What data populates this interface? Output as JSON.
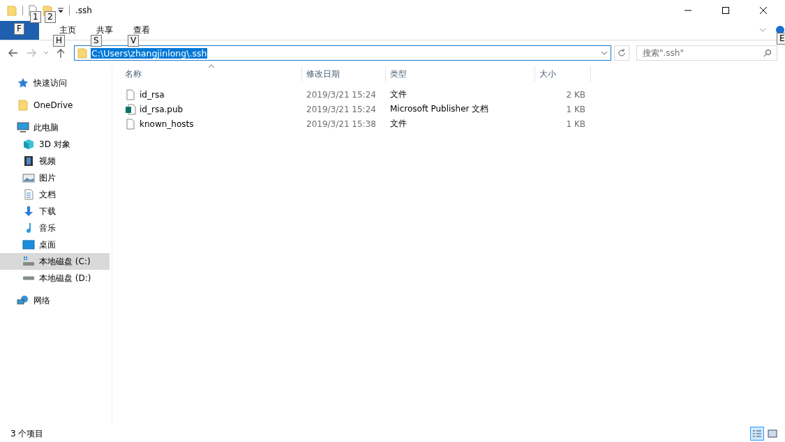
{
  "title_bar": {
    "title": ".ssh",
    "keytips": [
      "1",
      "2"
    ]
  },
  "ribbon": {
    "tabs": [
      {
        "keytip": "F",
        "kind": "file"
      },
      {
        "label": "主页",
        "keytip": "H",
        "kind": "tab"
      },
      {
        "label": "共享",
        "keytip": "S",
        "kind": "tab"
      },
      {
        "label": "查看",
        "keytip": "V",
        "kind": "tab"
      }
    ],
    "help_keytip": "E"
  },
  "address_bar": {
    "path": "C:\\Users\\zhangjinlong\\.ssh",
    "selected": true
  },
  "search": {
    "placeholder": "搜索\".ssh\""
  },
  "sidebar": {
    "items": [
      {
        "label": "快速访问",
        "kind": "star",
        "selected": false
      },
      {
        "label": "OneDrive",
        "kind": "folder",
        "selected": false
      },
      {
        "label": "此电脑",
        "kind": "pc",
        "selected": false,
        "children": [
          {
            "label": "3D 对象",
            "kind": "cube",
            "selected": false
          },
          {
            "label": "视频",
            "kind": "film",
            "selected": false
          },
          {
            "label": "图片",
            "kind": "picture",
            "selected": false
          },
          {
            "label": "文档",
            "kind": "document",
            "selected": false
          },
          {
            "label": "下载",
            "kind": "download",
            "selected": false
          },
          {
            "label": "音乐",
            "kind": "music",
            "selected": false
          },
          {
            "label": "桌面",
            "kind": "desktop",
            "selected": false
          },
          {
            "label": "本地磁盘 (C:)",
            "kind": "systemdrive",
            "selected": true
          },
          {
            "label": "本地磁盘 (D:)",
            "kind": "drive",
            "selected": false
          }
        ]
      },
      {
        "label": "网络",
        "kind": "network",
        "selected": false
      }
    ]
  },
  "file_list": {
    "columns": [
      "名称",
      "修改日期",
      "类型",
      "大小"
    ],
    "rows": [
      {
        "name": "id_rsa",
        "modified": "2019/3/21 15:24",
        "type": "文件",
        "size": "2 KB",
        "kind": "file"
      },
      {
        "name": "id_rsa.pub",
        "modified": "2019/3/21 15:24",
        "type": "Microsoft Publisher 文档",
        "size": "1 KB",
        "kind": "publisher"
      },
      {
        "name": "known_hosts",
        "modified": "2019/3/21 15:38",
        "type": "文件",
        "size": "1 KB",
        "kind": "file"
      }
    ]
  },
  "status_bar": {
    "count": "3 个项目",
    "views": [
      {
        "kind": "details",
        "selected": true
      },
      {
        "kind": "thumbnails",
        "selected": false
      }
    ]
  }
}
